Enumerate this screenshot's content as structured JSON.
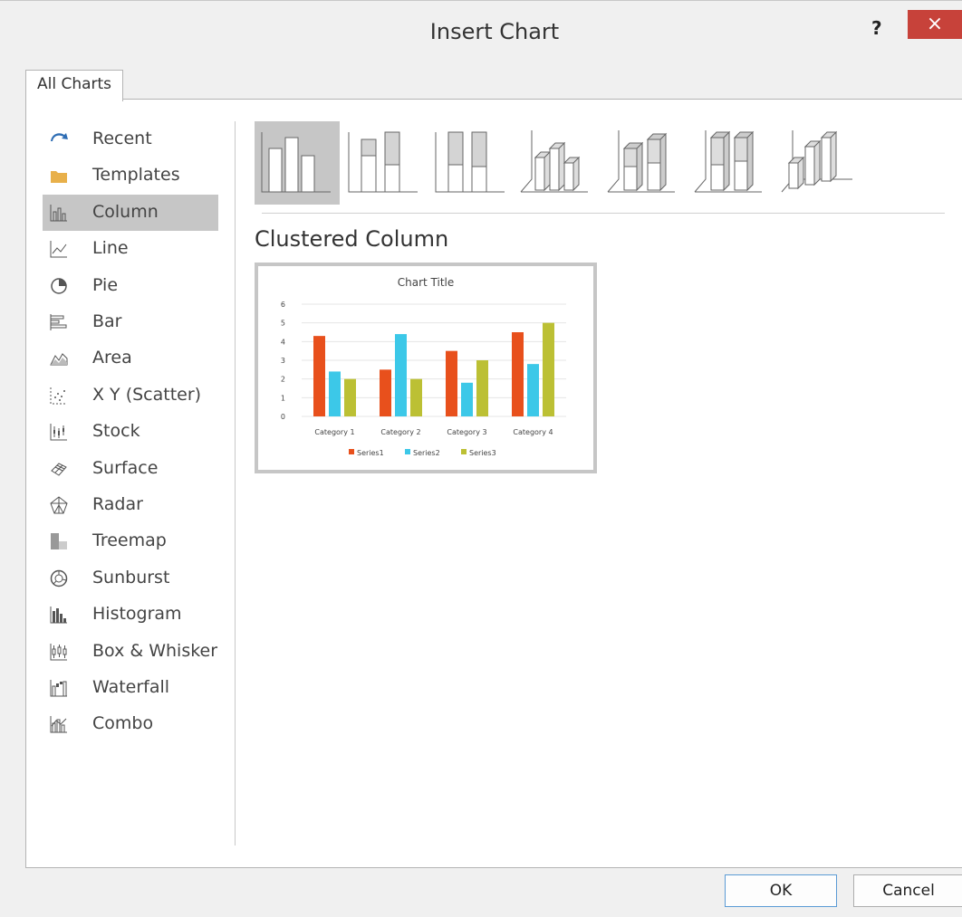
{
  "window": {
    "title": "Insert Chart",
    "help": "?",
    "close": "×"
  },
  "tabs": [
    {
      "label": "All Charts"
    }
  ],
  "sidebar": {
    "items": [
      {
        "label": "Recent",
        "icon": "recent-icon"
      },
      {
        "label": "Templates",
        "icon": "folder-icon"
      },
      {
        "label": "Column",
        "icon": "column-chart-icon",
        "selected": true
      },
      {
        "label": "Line",
        "icon": "line-chart-icon"
      },
      {
        "label": "Pie",
        "icon": "pie-chart-icon"
      },
      {
        "label": "Bar",
        "icon": "bar-chart-icon"
      },
      {
        "label": "Area",
        "icon": "area-chart-icon"
      },
      {
        "label": "X Y (Scatter)",
        "icon": "scatter-chart-icon"
      },
      {
        "label": "Stock",
        "icon": "stock-chart-icon"
      },
      {
        "label": "Surface",
        "icon": "surface-chart-icon"
      },
      {
        "label": "Radar",
        "icon": "radar-chart-icon"
      },
      {
        "label": "Treemap",
        "icon": "treemap-chart-icon"
      },
      {
        "label": "Sunburst",
        "icon": "sunburst-chart-icon"
      },
      {
        "label": "Histogram",
        "icon": "histogram-chart-icon"
      },
      {
        "label": "Box & Whisker",
        "icon": "box-whisker-chart-icon"
      },
      {
        "label": "Waterfall",
        "icon": "waterfall-chart-icon"
      },
      {
        "label": "Combo",
        "icon": "combo-chart-icon"
      }
    ]
  },
  "subtypes": {
    "selected_label": "Clustered Column",
    "items": [
      {
        "icon": "clustered-column-icon",
        "selected": true
      },
      {
        "icon": "stacked-column-icon"
      },
      {
        "icon": "100-stacked-column-icon"
      },
      {
        "icon": "3d-clustered-column-icon"
      },
      {
        "icon": "3d-stacked-column-icon"
      },
      {
        "icon": "3d-100-stacked-column-icon"
      },
      {
        "icon": "3d-column-icon"
      }
    ]
  },
  "buttons": {
    "ok": "OK",
    "cancel": "Cancel"
  },
  "colors": {
    "series1": "#e8501c",
    "series2": "#3cc8e8",
    "series3": "#bcc034",
    "selected_bg": "#c6c6c6",
    "close_bg": "#c7423a"
  },
  "chart_data": {
    "type": "bar",
    "title": "Chart Title",
    "categories": [
      "Category 1",
      "Category 2",
      "Category 3",
      "Category 4"
    ],
    "series": [
      {
        "name": "Series1",
        "values": [
          4.3,
          2.5,
          3.5,
          4.5
        ]
      },
      {
        "name": "Series2",
        "values": [
          2.4,
          4.4,
          1.8,
          2.8
        ]
      },
      {
        "name": "Series3",
        "values": [
          2,
          2,
          3,
          5
        ]
      }
    ],
    "ylim": [
      0,
      6
    ],
    "yticks": [
      "0",
      "1",
      "2",
      "3",
      "4",
      "5",
      "6"
    ],
    "grid": true,
    "legend": "bottom"
  }
}
